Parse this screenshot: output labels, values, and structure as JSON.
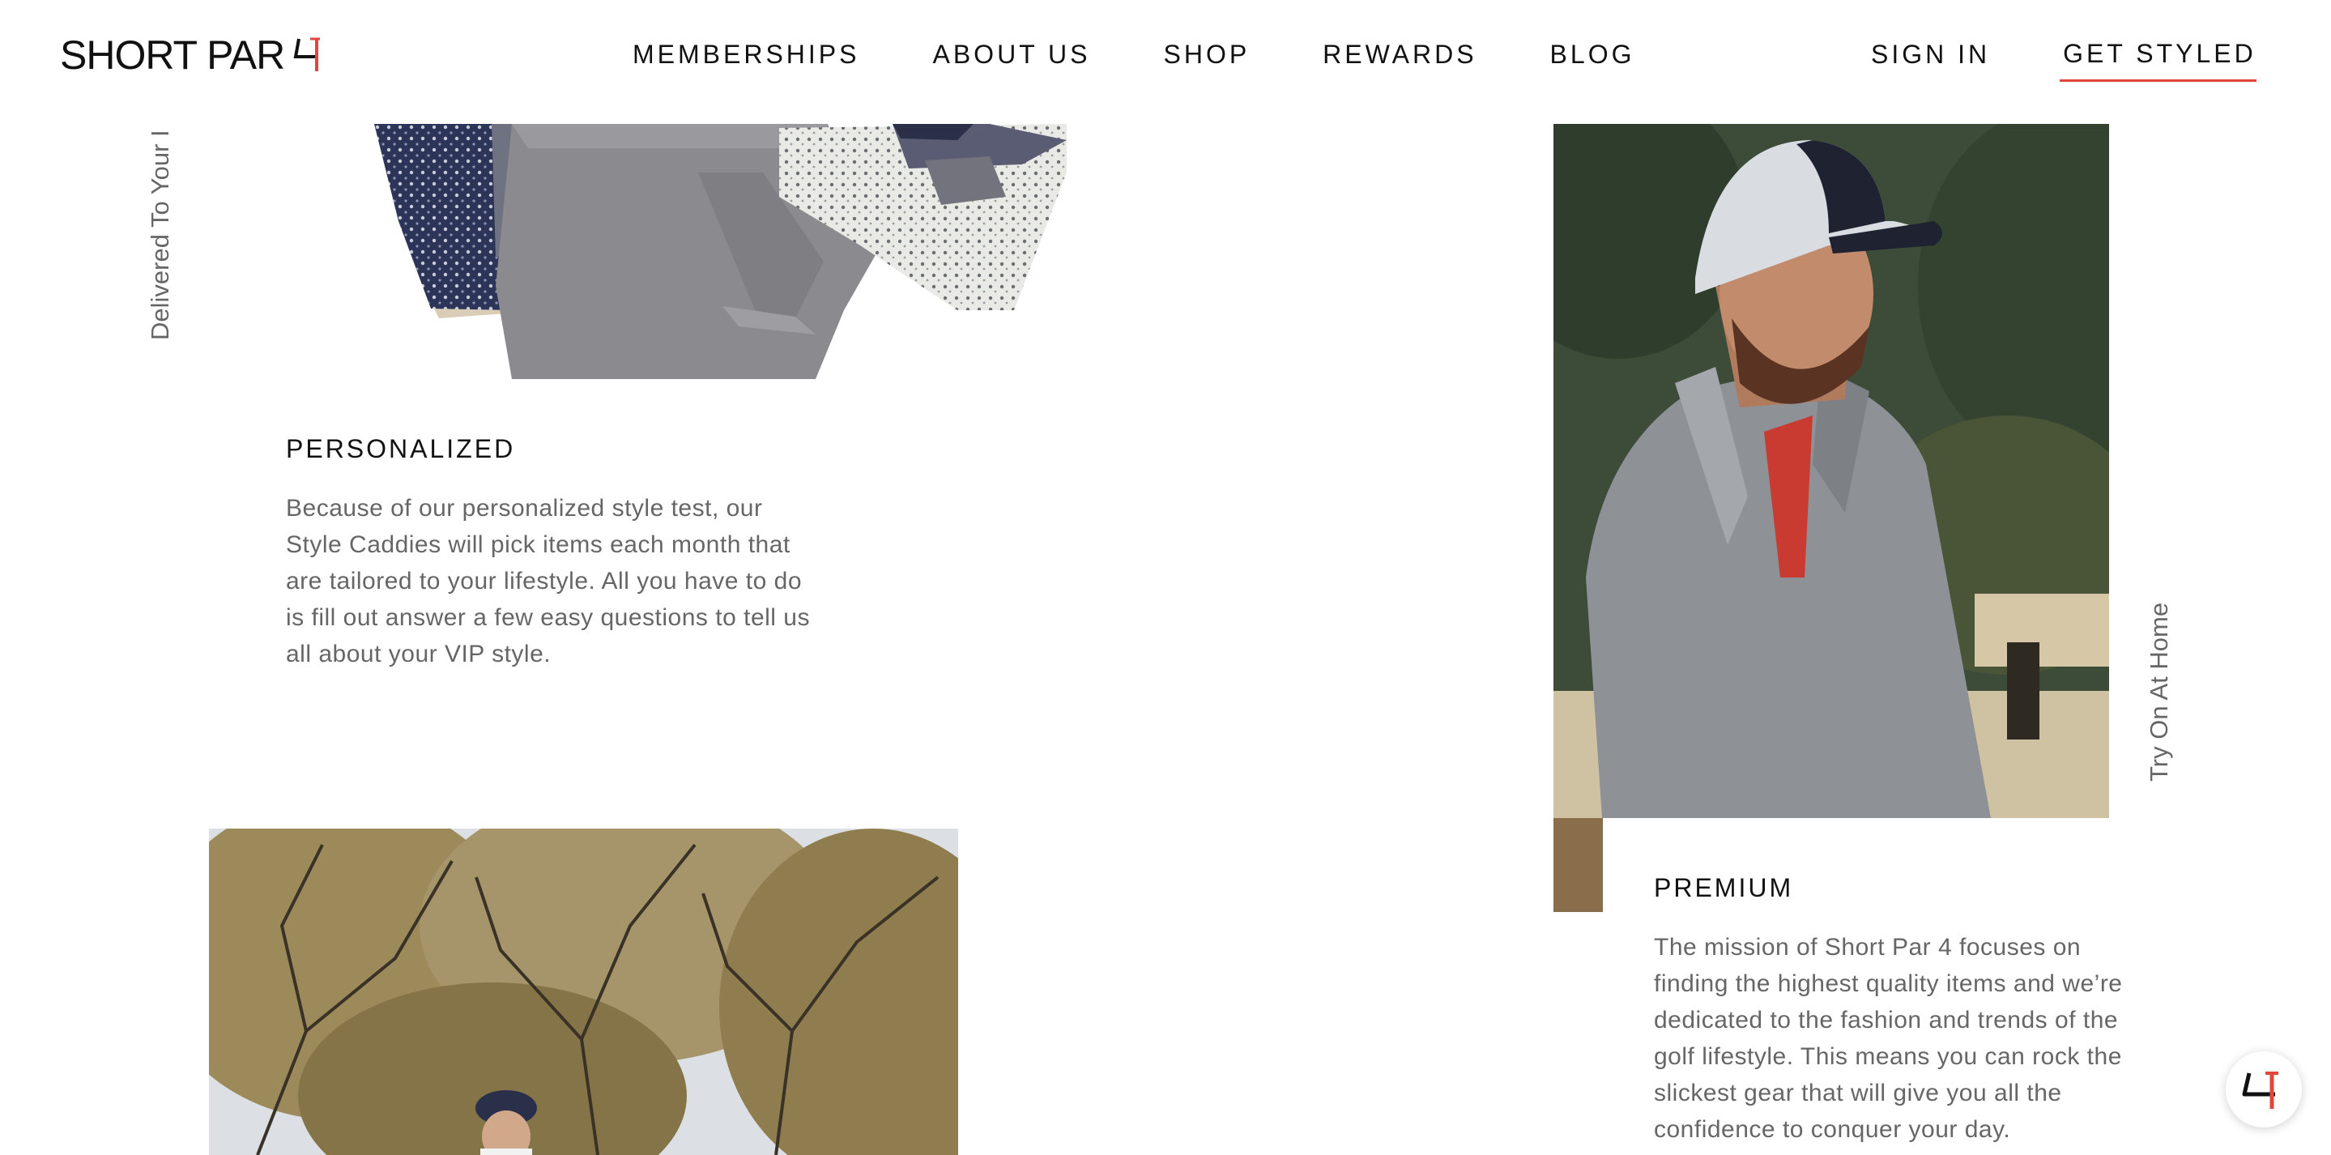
{
  "brand": {
    "name": "SHORT PAR",
    "logo_icon": "par-4-logo-mark",
    "accent_color": "#e0463a"
  },
  "nav": {
    "main": [
      "MEMBERSHIPS",
      "ABOUT US",
      "SHOP",
      "REWARDS",
      "BLOG"
    ],
    "sign_in": "SIGN IN",
    "get_styled": "GET STYLED"
  },
  "side_labels": {
    "left": "Delivered To Your I",
    "right": "Try On At Home"
  },
  "features": {
    "personalized": {
      "title": "PERSONALIZED",
      "body": "Because of our personalized style test, our Style Caddies will pick items each month that are tailored to your lifestyle. All you have to do is fill out answer a few easy questions to tell us all about your VIP style."
    },
    "premium": {
      "title": "PREMIUM",
      "body": "The mission of Short Par 4 focuses on finding the highest quality items and we’re dedicated to the fashion and trends of the golf lifestyle. This means you can rock the slickest gear that will give you all the confidence to conquer your day."
    }
  },
  "chat": {
    "icon": "chat-launcher-icon"
  }
}
